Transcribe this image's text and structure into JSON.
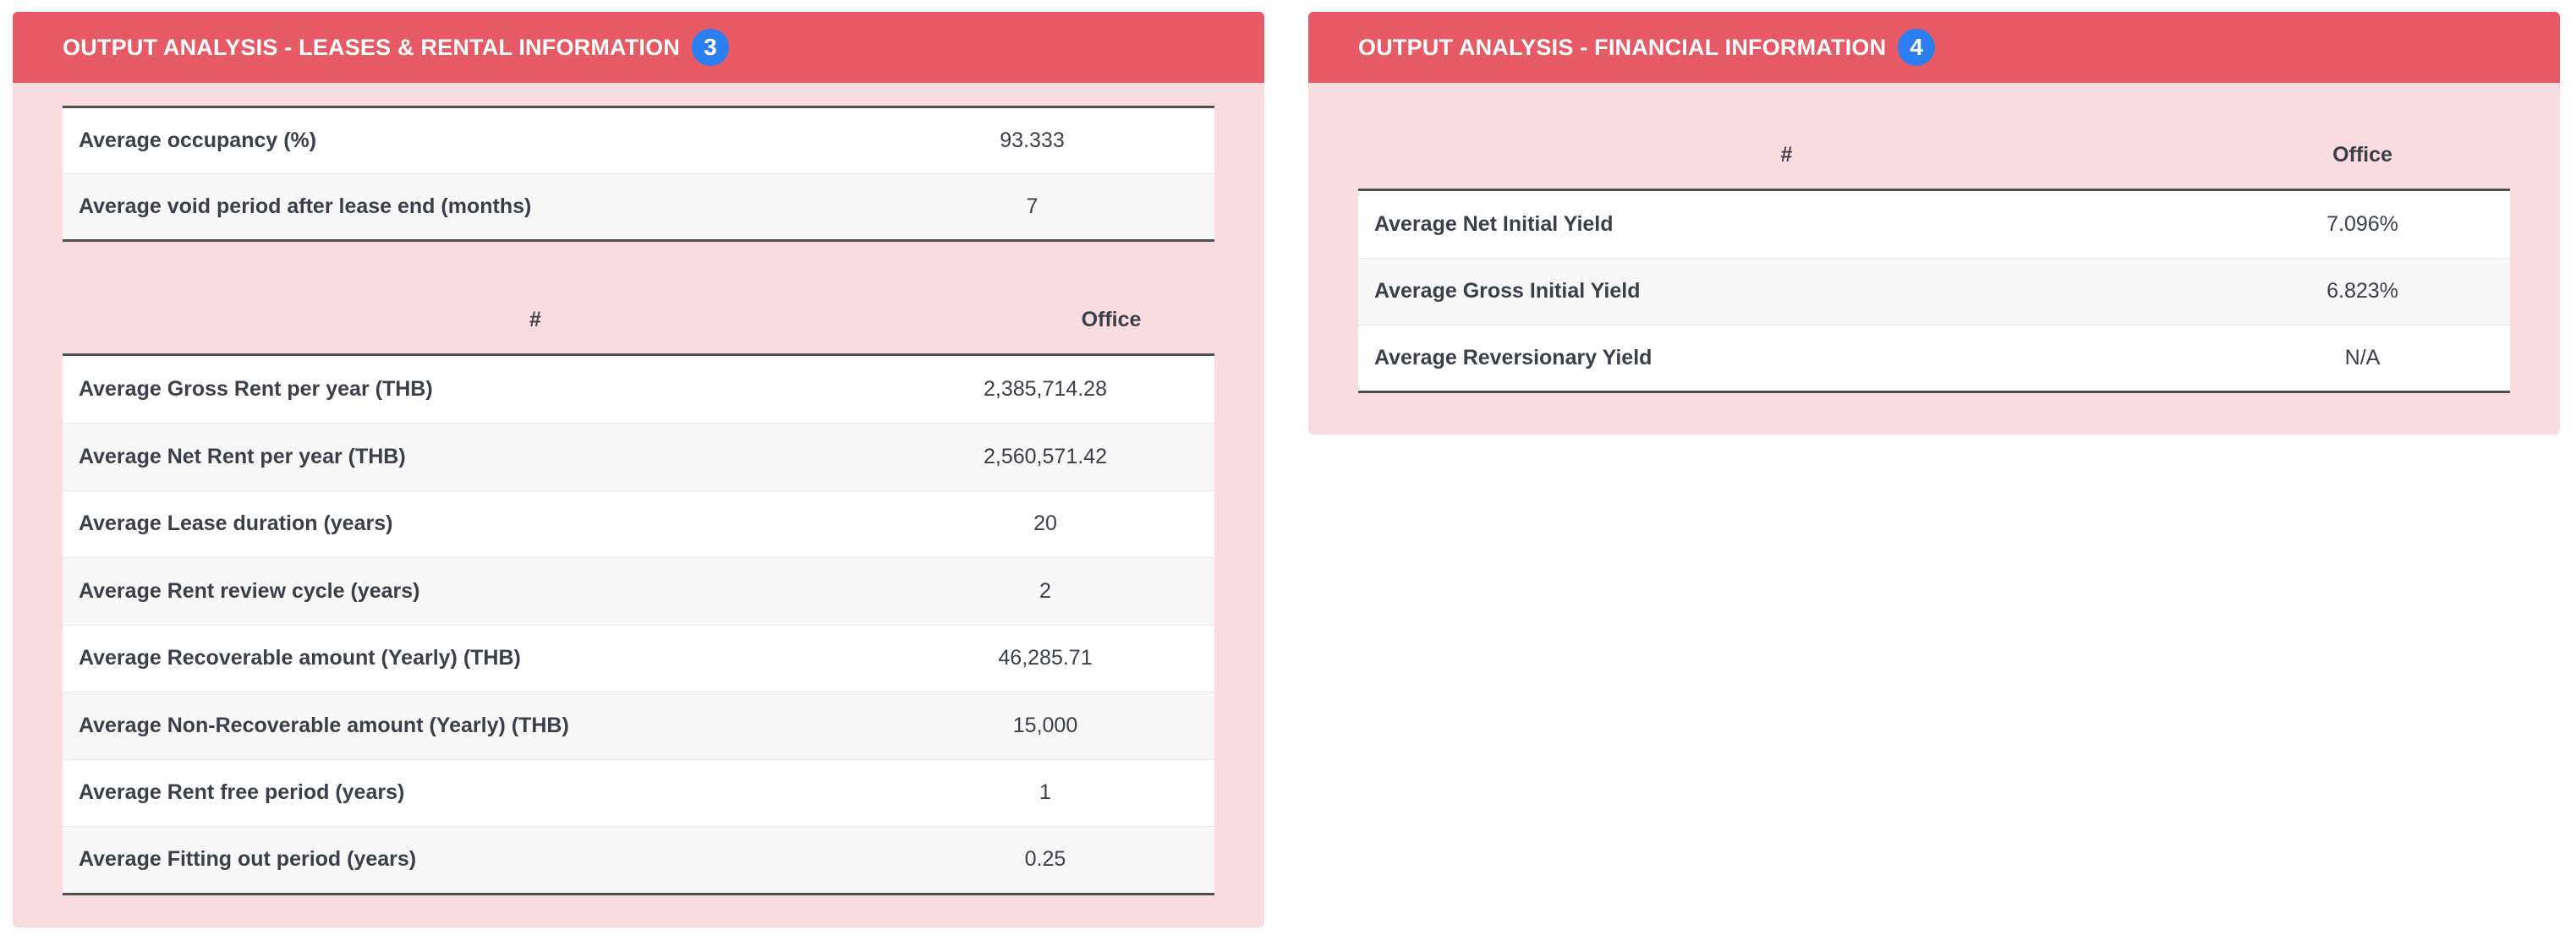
{
  "leases_panel": {
    "title": "OUTPUT ANALYSIS - LEASES & RENTAL INFORMATION",
    "badge": "3",
    "occupancy_rows": [
      {
        "label": "Average occupancy (%)",
        "value": "93.333"
      },
      {
        "label": "Average void period after lease end (months)",
        "value": "7"
      }
    ],
    "columns": {
      "hash": "#",
      "office": "Office"
    },
    "rent_rows": [
      {
        "label": "Average Gross Rent per year (THB)",
        "value": "2,385,714.28"
      },
      {
        "label": "Average Net Rent per year (THB)",
        "value": "2,560,571.42"
      },
      {
        "label": "Average Lease duration (years)",
        "value": "20"
      },
      {
        "label": "Average Rent review cycle (years)",
        "value": "2"
      },
      {
        "label": "Average Recoverable amount (Yearly) (THB)",
        "value": "46,285.71"
      },
      {
        "label": "Average Non-Recoverable amount (Yearly) (THB)",
        "value": "15,000"
      },
      {
        "label": "Average Rent free period (years)",
        "value": "1"
      },
      {
        "label": "Average Fitting out period (years)",
        "value": "0.25"
      }
    ]
  },
  "financial_panel": {
    "title": "OUTPUT ANALYSIS - FINANCIAL INFORMATION",
    "badge": "4",
    "columns": {
      "hash": "#",
      "office": "Office"
    },
    "rows": [
      {
        "label": "Average Net Initial Yield",
        "value": "7.096%"
      },
      {
        "label": "Average Gross Initial Yield",
        "value": "6.823%"
      },
      {
        "label": "Average Reversionary Yield",
        "value": "N/A"
      }
    ]
  },
  "colors": {
    "header_bg": "#e55a65",
    "panel_bg": "#f8dce0",
    "badge_bg": "#2d7ff0",
    "text": "#3a3f4a"
  }
}
